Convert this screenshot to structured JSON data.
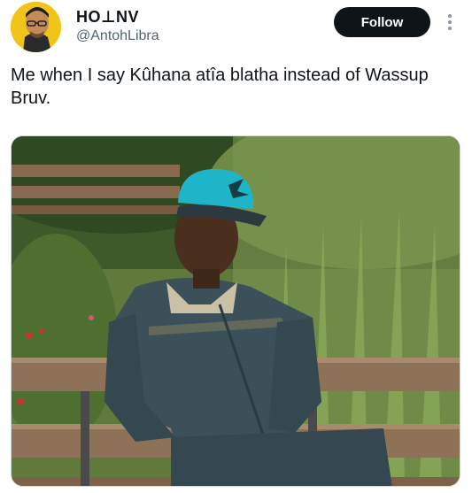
{
  "author": {
    "display_name": "HO⊥NV",
    "handle": "@AntohLibra",
    "avatar_icon": "profile-avatar"
  },
  "actions": {
    "follow_label": "Follow",
    "more_icon": "more-options-icon"
  },
  "tweet": {
    "text": "Me when I say Kûhana atîa blatha instead of Wassup Bruv."
  },
  "colors": {
    "follow_bg": "#0f1419",
    "handle": "#536471",
    "avatar_bg": "#f0c419",
    "cap": "#1fb5c9"
  }
}
